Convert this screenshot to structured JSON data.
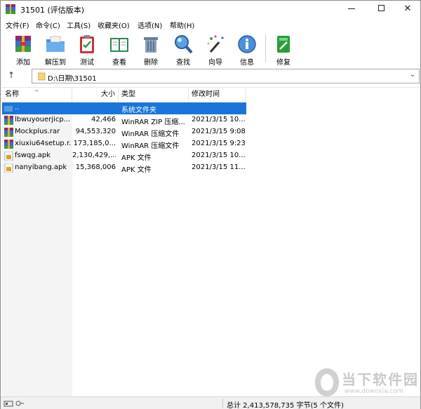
{
  "window": {
    "title": "31501 (评估版本)",
    "minimize": "—",
    "close": "✕"
  },
  "menu": [
    "文件(F)",
    "命令(C)",
    "工具(S)",
    "收藏夹(O)",
    "选项(N)",
    "帮助(H)"
  ],
  "toolbar": {
    "add": "添加",
    "extract": "解压到",
    "test": "测试",
    "view": "查看",
    "delete": "删除",
    "find": "查找",
    "wizard": "向导",
    "info": "信息",
    "repair": "修复"
  },
  "address": {
    "up_icon": "↑",
    "path": "D:\\日期\\31501",
    "chevron": "⌄"
  },
  "columns": {
    "name": "名称",
    "size": "大小",
    "type": "类型",
    "date": "修改时间",
    "sort_caret": "^"
  },
  "files": [
    {
      "name": "..",
      "size": "",
      "type": "系统文件夹",
      "date": "",
      "icon": "folder-up-icon"
    },
    {
      "name": "lbwuyouerjicp...",
      "size": "42,466",
      "type": "WinRAR ZIP 压缩...",
      "date": "2021/3/15 10...",
      "icon": "rar-file-icon"
    },
    {
      "name": "Mockplus.rar",
      "size": "94,553,320",
      "type": "WinRAR 压缩文件",
      "date": "2021/3/15 9:08",
      "icon": "rar-file-icon"
    },
    {
      "name": "xiuxiu64setup.r...",
      "size": "173,185,0...",
      "type": "WinRAR 压缩文件",
      "date": "2021/3/15 9:23",
      "icon": "rar-file-icon"
    },
    {
      "name": "fswqg.apk",
      "size": "2,130,429,...",
      "type": "APK 文件",
      "date": "2021/3/15 10...",
      "icon": "apk-file-icon"
    },
    {
      "name": "nanyibang.apk",
      "size": "15,368,006",
      "type": "APK 文件",
      "date": "2021/3/15 11...",
      "icon": "apk-file-icon"
    }
  ],
  "status": {
    "summary": "总计 2,413,578,735 字节(5 个文件)"
  },
  "watermark": {
    "text": "当下软件园",
    "url": "www.downxia.com"
  },
  "colors": {
    "selection": "#1a74d9",
    "accent_green": "#2a9d3a",
    "rar_red": "#b0243a"
  }
}
